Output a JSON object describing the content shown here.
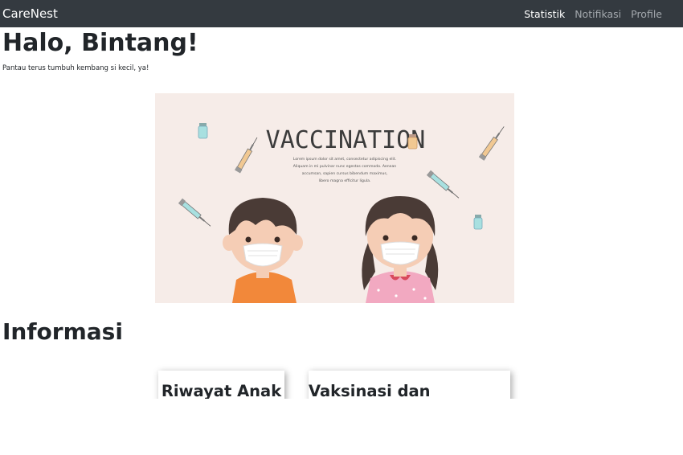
{
  "navbar": {
    "brand": "CareNest",
    "links": [
      {
        "label": "Statistik",
        "active": true
      },
      {
        "label": "Notifikasi",
        "active": false
      },
      {
        "label": "Profile",
        "active": false
      }
    ]
  },
  "greeting": "Halo, Bintang!",
  "subtitle": "Pantau terus tumbuh kembang si kecil, ya!",
  "hero": {
    "title": "VACCINATION",
    "body_lines": [
      "Lorem ipsum dolor sit amet, consectetur adipiscing elit.",
      "Aliquam in mi pulvinar nunc egestas commodo. Aenean",
      "accumsan, sapien cursus bibendum maximus,",
      "libero magna efficitur ligula."
    ]
  },
  "section_title": "Informasi",
  "cards": [
    {
      "label": "Riwayat Anak"
    },
    {
      "label": "Vaksinasi dan Imunisasi"
    }
  ],
  "colors": {
    "navbar_bg": "#343a40",
    "hero_bg": "#f6ece8",
    "boy_shirt": "#f2883a",
    "girl_dress": "#f2a9c1",
    "hair": "#4a3b36"
  }
}
